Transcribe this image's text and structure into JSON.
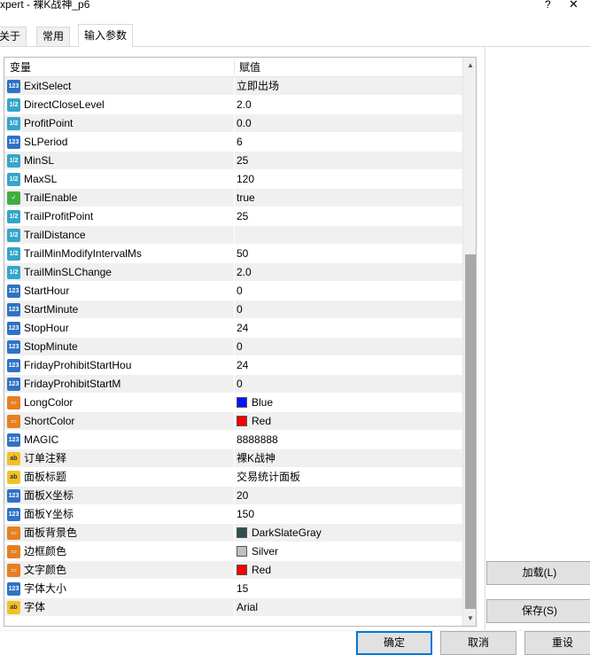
{
  "window": {
    "title": "xpert - 裸K战神_p6",
    "help_glyph": "?",
    "close_glyph": "✕"
  },
  "tabs": [
    {
      "label": "关于"
    },
    {
      "label": "常用"
    },
    {
      "label": "输入参数"
    }
  ],
  "grid": {
    "col_name": "变量",
    "col_value": "赋值",
    "rows": [
      {
        "type": "int",
        "name": "ExitSelect",
        "value": "立即出场"
      },
      {
        "type": "double",
        "name": "DirectCloseLevel",
        "value": "2.0"
      },
      {
        "type": "double",
        "name": "ProfitPoint",
        "value": "0.0"
      },
      {
        "type": "int",
        "name": "SLPeriod",
        "value": "6"
      },
      {
        "type": "double",
        "name": "MinSL",
        "value": "25"
      },
      {
        "type": "double",
        "name": "MaxSL",
        "value": "120"
      },
      {
        "type": "bool",
        "name": "TrailEnable",
        "value": "true"
      },
      {
        "type": "double",
        "name": "TrailProfitPoint",
        "value": "25"
      },
      {
        "type": "double",
        "name": "TrailDistance",
        "value": ""
      },
      {
        "type": "double",
        "name": "TrailMinModifyIntervalMs",
        "value": "50"
      },
      {
        "type": "double",
        "name": "TrailMinSLChange",
        "value": "2.0"
      },
      {
        "type": "int",
        "name": "StartHour",
        "value": "0"
      },
      {
        "type": "int",
        "name": "StartMinute",
        "value": "0"
      },
      {
        "type": "int",
        "name": "StopHour",
        "value": "24"
      },
      {
        "type": "int",
        "name": "StopMinute",
        "value": "0"
      },
      {
        "type": "int",
        "name": "FridayProhibitStartHou",
        "value": "24"
      },
      {
        "type": "int",
        "name": "FridayProhibitStartM",
        "value": "0"
      },
      {
        "type": "color",
        "name": "LongColor",
        "value": "Blue",
        "swatch": "#0015ff"
      },
      {
        "type": "color",
        "name": "ShortColor",
        "value": "Red",
        "swatch": "#ff0000"
      },
      {
        "type": "int",
        "name": "MAGIC",
        "value": "8888888"
      },
      {
        "type": "string",
        "name": "订单注释",
        "value": "裸K战神"
      },
      {
        "type": "string",
        "name": "面板标题",
        "value": "交易统计面板"
      },
      {
        "type": "int",
        "name": "面板X坐标",
        "value": "20"
      },
      {
        "type": "int",
        "name": "面板Y坐标",
        "value": "150"
      },
      {
        "type": "color",
        "name": "面板背景色",
        "value": "DarkSlateGray",
        "swatch": "#2f4f4f"
      },
      {
        "type": "color",
        "name": "边框颜色",
        "value": "Silver",
        "swatch": "#c0c0c0"
      },
      {
        "type": "color",
        "name": "文字颜色",
        "value": "Red",
        "swatch": "#ff0000"
      },
      {
        "type": "int",
        "name": "字体大小",
        "value": "15"
      },
      {
        "type": "string",
        "name": "字体",
        "value": "Arial"
      }
    ]
  },
  "type_icons": {
    "int": "123",
    "double": "1/2",
    "bool": "✓",
    "color": "▭",
    "string": "ab"
  },
  "buttons": {
    "load": "加载(L)",
    "save": "保存(S)",
    "ok": "确定",
    "cancel": "取消",
    "reset": "重设"
  }
}
